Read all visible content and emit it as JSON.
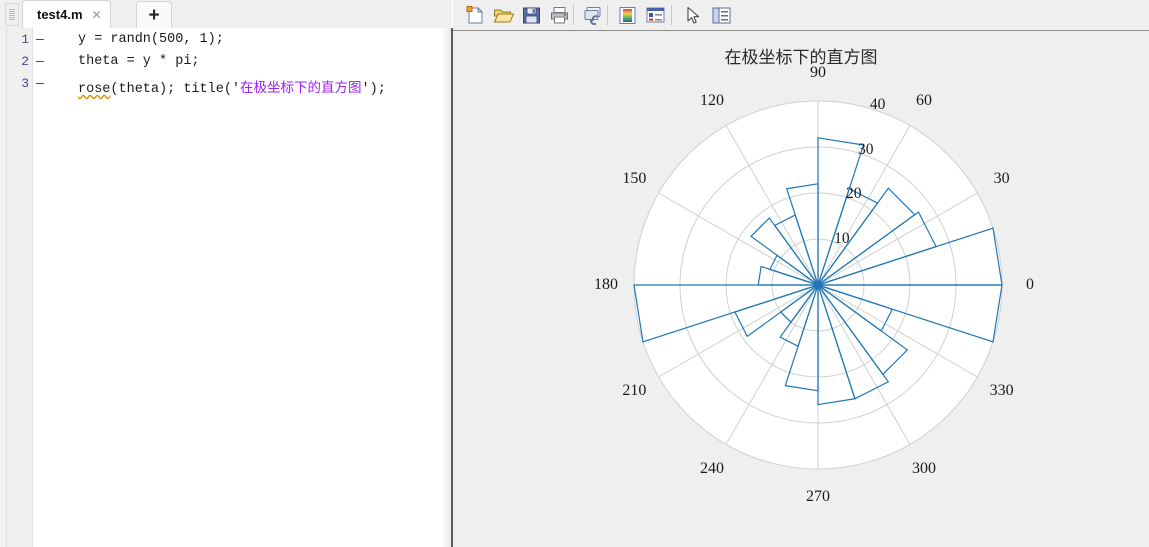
{
  "editor": {
    "tab": {
      "filename": "test4.m",
      "close_label": "✕",
      "add_tab_label": "+"
    },
    "lines": [
      {
        "number": "1",
        "marker": "—",
        "prefix": "",
        "warn": "",
        "code": "y = randn(500, 1);",
        "string": ""
      },
      {
        "number": "2",
        "marker": "—",
        "prefix": "",
        "warn": "",
        "code": "theta = y * pi;",
        "string": ""
      },
      {
        "number": "3",
        "marker": "—",
        "prefix": "",
        "warn": "rose",
        "code": "(theta); title('",
        "string": "在极坐标下的直方图",
        "suffix": "');"
      }
    ]
  },
  "figure": {
    "toolbar": [
      {
        "name": "new-figure-icon",
        "title": "New Figure"
      },
      {
        "name": "open-file-icon",
        "title": "Open File"
      },
      {
        "name": "save-figure-icon",
        "title": "Save Figure"
      },
      {
        "name": "print-figure-icon",
        "title": "Print Figure"
      },
      {
        "name": "link-plot-icon",
        "title": "Link Plot"
      },
      {
        "name": "colorbar-icon",
        "title": "Insert Colorbar"
      },
      {
        "name": "legend-icon",
        "title": "Insert Legend"
      },
      {
        "name": "edit-plot-pointer-icon",
        "title": "Edit Plot"
      },
      {
        "name": "property-inspector-icon",
        "title": "Open Property Inspector"
      }
    ]
  },
  "chart_data": {
    "type": "polar_histogram",
    "title": "在极坐标下的直方图",
    "xlabel": "",
    "ylabel": "",
    "grid": true,
    "legend": null,
    "theta_unit": "degrees",
    "theta_tick_labels": [
      "0",
      "30",
      "60",
      "90",
      "120",
      "150",
      "180",
      "210",
      "240",
      "270",
      "300",
      "330"
    ],
    "theta_ticks": [
      0,
      30,
      60,
      90,
      120,
      150,
      180,
      210,
      240,
      270,
      300,
      330
    ],
    "r_tick_labels": [
      "10",
      "20",
      "30",
      "40"
    ],
    "r_ticks": [
      10,
      20,
      30,
      40
    ],
    "rlim": [
      0,
      40
    ],
    "r_label_angle": 75,
    "n_bins": 20,
    "bin_width_deg": 18,
    "bin_centers_deg": [
      9,
      27,
      45,
      63,
      81,
      99,
      117,
      135,
      153,
      171,
      189,
      207,
      225,
      243,
      261,
      279,
      297,
      315,
      333,
      351
    ],
    "counts": [
      40,
      27,
      26,
      22,
      32,
      22,
      16,
      18,
      11,
      13,
      40,
      19,
      10,
      14,
      23,
      26,
      26,
      24,
      17,
      40
    ],
    "line_color": "#1f77b4",
    "grid_color": "#d0d0d0",
    "axes_bg": "#ffffff",
    "figure_bg": "#efefef"
  }
}
